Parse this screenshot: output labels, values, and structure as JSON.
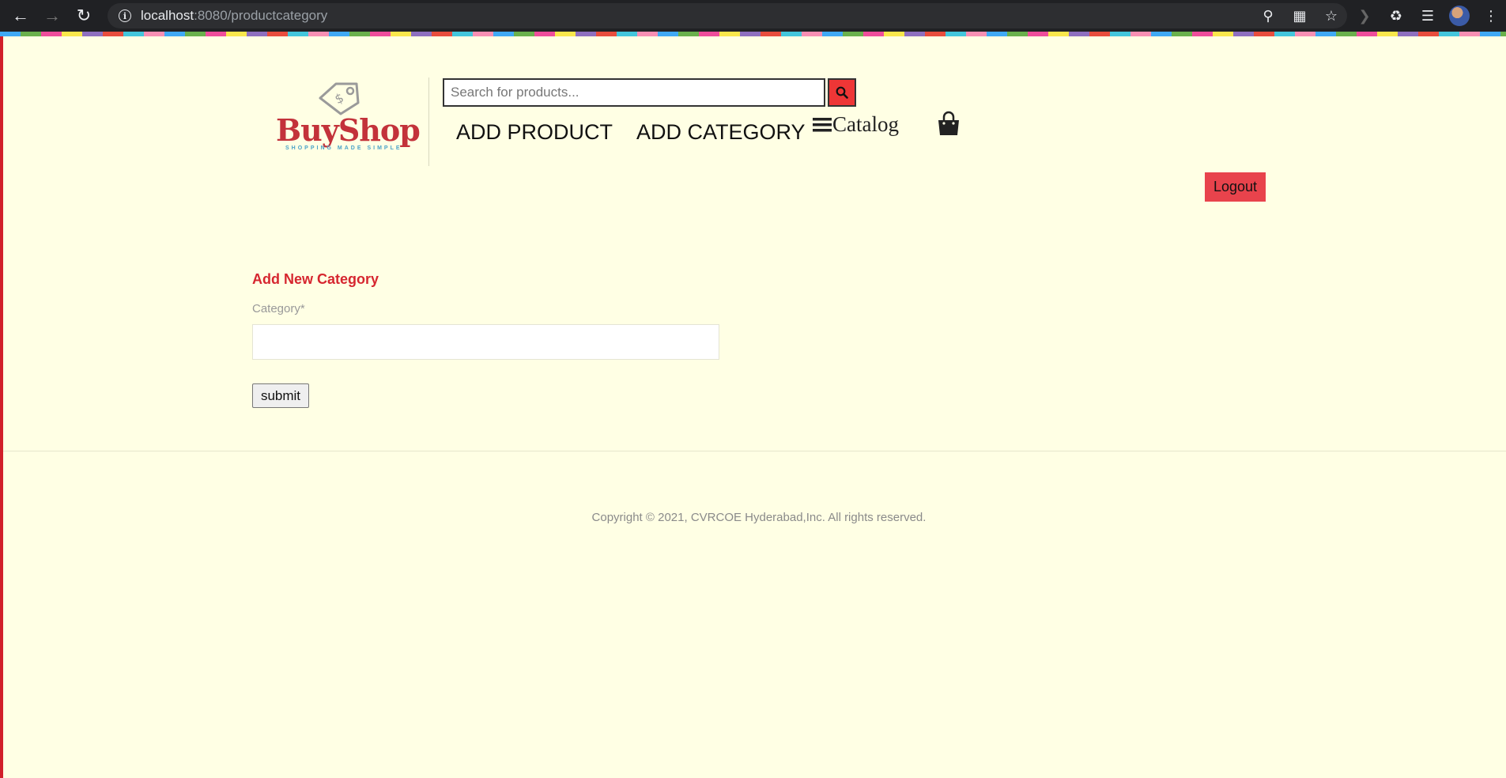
{
  "browser": {
    "url_host": "localhost",
    "url_rest": ":8080/productcategory"
  },
  "header": {
    "logo_text": "BuyShop",
    "logo_tagline": "SHOPPING MADE SIMPLE",
    "search_placeholder": "Search for products...",
    "nav": {
      "add_product": "ADD PRODUCT",
      "add_category": "ADD CATEGORY",
      "catalog": "Catalog"
    },
    "logout_label": "Logout"
  },
  "form": {
    "title": "Add New Category",
    "category_label": "Category*",
    "category_value": "",
    "submit_label": "submit"
  },
  "footer": {
    "copyright": "Copyright © 2021, CVRCOE Hyderabad,Inc. All rights reserved."
  },
  "colors": {
    "accent_red": "#ee3636",
    "title_red": "#d6262f",
    "page_bg": "#ffffe4"
  }
}
